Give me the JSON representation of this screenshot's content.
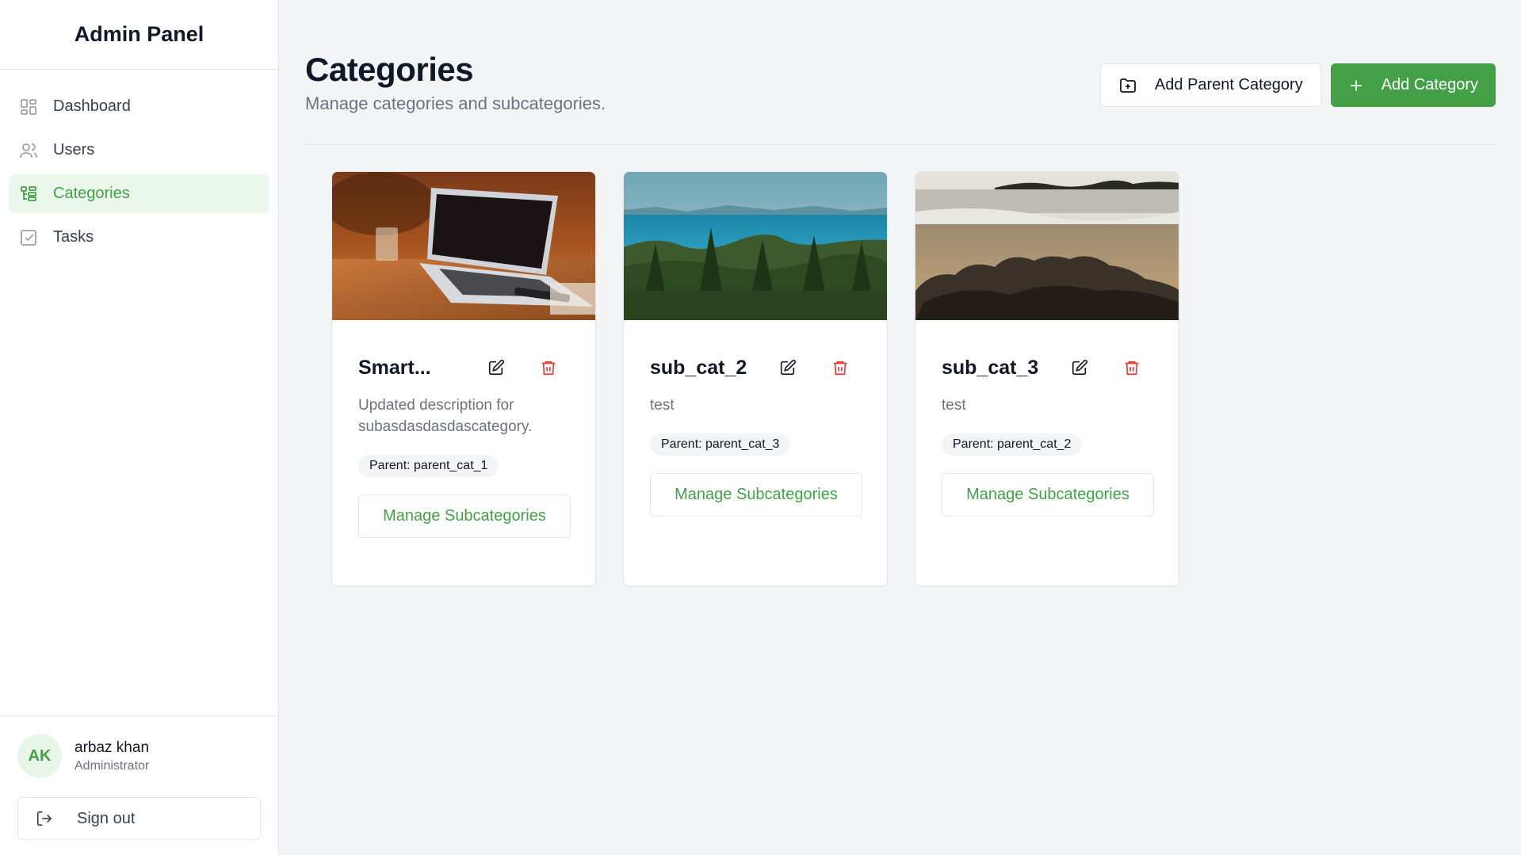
{
  "app": {
    "title": "Admin Panel"
  },
  "sidebar": {
    "items": [
      {
        "label": "Dashboard",
        "icon": "dashboard-icon"
      },
      {
        "label": "Users",
        "icon": "users-icon"
      },
      {
        "label": "Categories",
        "icon": "categories-icon",
        "active": true
      },
      {
        "label": "Tasks",
        "icon": "tasks-icon"
      }
    ],
    "user": {
      "initials": "AK",
      "name": "arbaz khan",
      "role": "Administrator"
    },
    "signout_label": "Sign out"
  },
  "header": {
    "title": "Categories",
    "subtitle": "Manage categories and subcategories.",
    "add_parent_label": "Add Parent Category",
    "add_category_label": "Add Category"
  },
  "cards": [
    {
      "name": "Smart...",
      "description": "Updated description for subasdasdasdascategory.",
      "parent": "Parent: parent_cat_1",
      "manage_label": "Manage Subcategories",
      "image": "laptop-photo"
    },
    {
      "name": "sub_cat_2",
      "description": "test",
      "parent": "Parent: parent_cat_3",
      "manage_label": "Manage Subcategories",
      "image": "forest-lake-photo"
    },
    {
      "name": "sub_cat_3",
      "description": "test",
      "parent": "Parent: parent_cat_2",
      "manage_label": "Manage Subcategories",
      "image": "beach-rocks-photo"
    }
  ],
  "colors": {
    "accent": "#43a047",
    "accent_bg": "#ecf7ec",
    "danger": "#e53935",
    "background": "#f3f4f6"
  }
}
